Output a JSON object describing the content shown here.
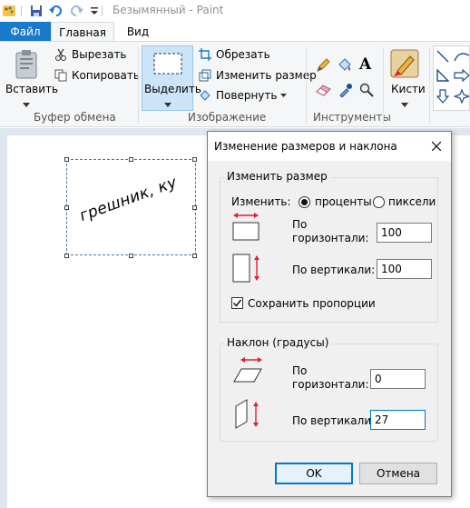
{
  "window": {
    "title": "Безымянный - Paint"
  },
  "ribbon": {
    "tabs": [
      {
        "label": "Файл"
      },
      {
        "label": "Главная"
      },
      {
        "label": "Вид"
      }
    ],
    "clipboard": {
      "paste_label": "Вставить",
      "cut_label": "Вырезать",
      "copy_label": "Копировать",
      "group_label": "Буфер обмена"
    },
    "image": {
      "select_label": "Выделить",
      "crop_label": "Обрезать",
      "resize_label": "Изменить размер",
      "rotate_label": "Повернуть",
      "group_label": "Изображение"
    },
    "tools": {
      "text_tool_glyph": "A",
      "group_label": "Инструменты"
    },
    "brushes": {
      "label": "Кисти"
    }
  },
  "canvas": {
    "text": "грешник, ку"
  },
  "dialog": {
    "title": "Изменение размеров и наклона",
    "resize": {
      "legend": "Изменить размер",
      "by_label": "Изменить:",
      "percent_label": "проценты",
      "pixels_label": "пиксели",
      "selected_unit": "проценты",
      "horizontal_label_1": "По",
      "horizontal_label_2": "горизонтали:",
      "horizontal_value": "100",
      "vertical_label": "По вертикали:",
      "vertical_value": "100",
      "keep_ratio_label": "Сохранить пропорции",
      "keep_ratio_checked": true
    },
    "skew": {
      "legend": "Наклон (градусы)",
      "horizontal_label_1": "По",
      "horizontal_label_2": "горизонтали:",
      "horizontal_value": "0",
      "vertical_label": "По вертикали:",
      "vertical_value": "27"
    },
    "ok_label": "OK",
    "cancel_label": "Отмена"
  },
  "colors": {
    "accent": "#1979ca",
    "arrow_red": "#e0202a",
    "selection_blue": "#cce4f7"
  }
}
